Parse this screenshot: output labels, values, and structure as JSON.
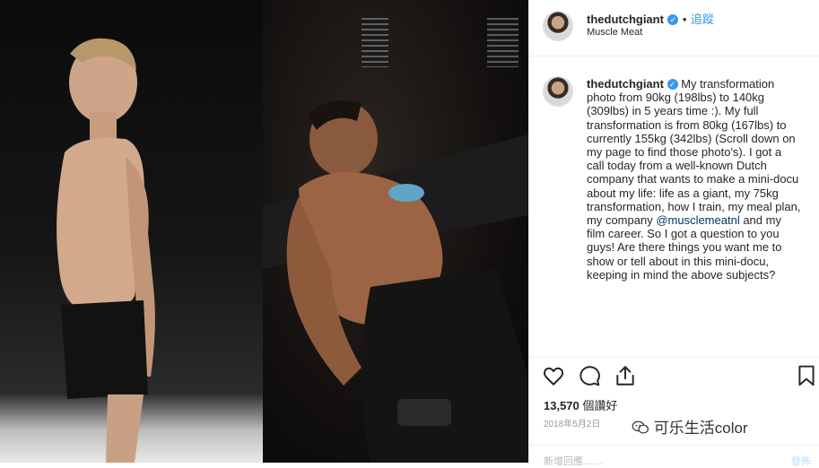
{
  "post": {
    "username": "thedutchgiant",
    "follow_label": "追蹤",
    "location": "Muscle Meat",
    "caption_pre": "My transformation photo from 90kg (198lbs) to 140kg (309lbs) in 5 years time :). My full transformation is from 80kg (167lbs) to currently 155kg (342lbs) (Scroll down on my page to find those photo's). I got a call today from a well-known Dutch company that wants to make a mini-docu about my life: life as a giant, my 75kg transformation, how I train, my meal plan, my company ",
    "caption_mention": "@musclemeatnl",
    "caption_post": " and my film career. So I got a question to you guys! Are there things you want me to show or tell about in this mini-docu, keeping in mind the above subjects?",
    "likes_count": "13,570",
    "likes_suffix": "個讚好",
    "date": "2018年5月2日",
    "comment_placeholder": "新增回應……",
    "post_label": "發佈"
  },
  "watermark": "可乐生活color",
  "icons": {
    "like": "heart-icon",
    "comment": "comment-icon",
    "share": "share-icon",
    "save": "bookmark-icon",
    "verified": "verified-badge-icon",
    "watermark": "wechat-icon"
  },
  "colors": {
    "verified": "#3897f0",
    "follow": "#3897f0",
    "mention": "#003569"
  }
}
